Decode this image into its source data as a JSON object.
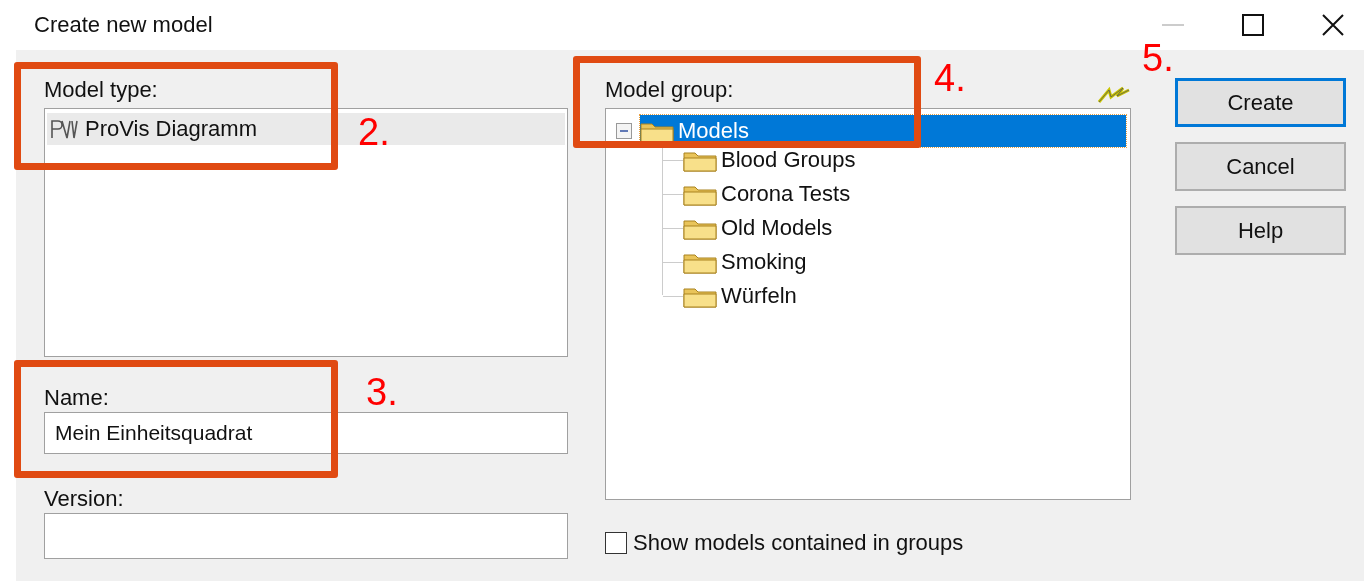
{
  "window": {
    "title": "Create new model"
  },
  "model_type": {
    "label": "Model type:",
    "items": [
      {
        "text": "ProVis Diagramm",
        "selected": true
      }
    ]
  },
  "name": {
    "label": "Name:",
    "value": "Mein Einheitsquadrat"
  },
  "version": {
    "label": "Version:"
  },
  "model_group": {
    "label": "Model group:",
    "tree": [
      {
        "text": "Models",
        "selected": true,
        "expanded": true,
        "children": [
          {
            "text": "Blood Groups",
            "selected": false
          },
          {
            "text": "Corona Tests",
            "selected": false
          },
          {
            "text": "Old Models",
            "selected": false
          },
          {
            "text": "Smoking",
            "selected": false
          },
          {
            "text": "Würfeln",
            "selected": false
          }
        ]
      }
    ]
  },
  "show_models_in_groups": {
    "label": "Show models contained in groups",
    "checked": false
  },
  "buttons": [
    {
      "label": "Create",
      "default": true
    },
    {
      "label": "Cancel",
      "default": false
    },
    {
      "label": "Help",
      "default": false
    }
  ],
  "annotations": [
    {
      "number": "2."
    },
    {
      "number": "3."
    },
    {
      "number": "4."
    },
    {
      "number": "5."
    }
  ]
}
